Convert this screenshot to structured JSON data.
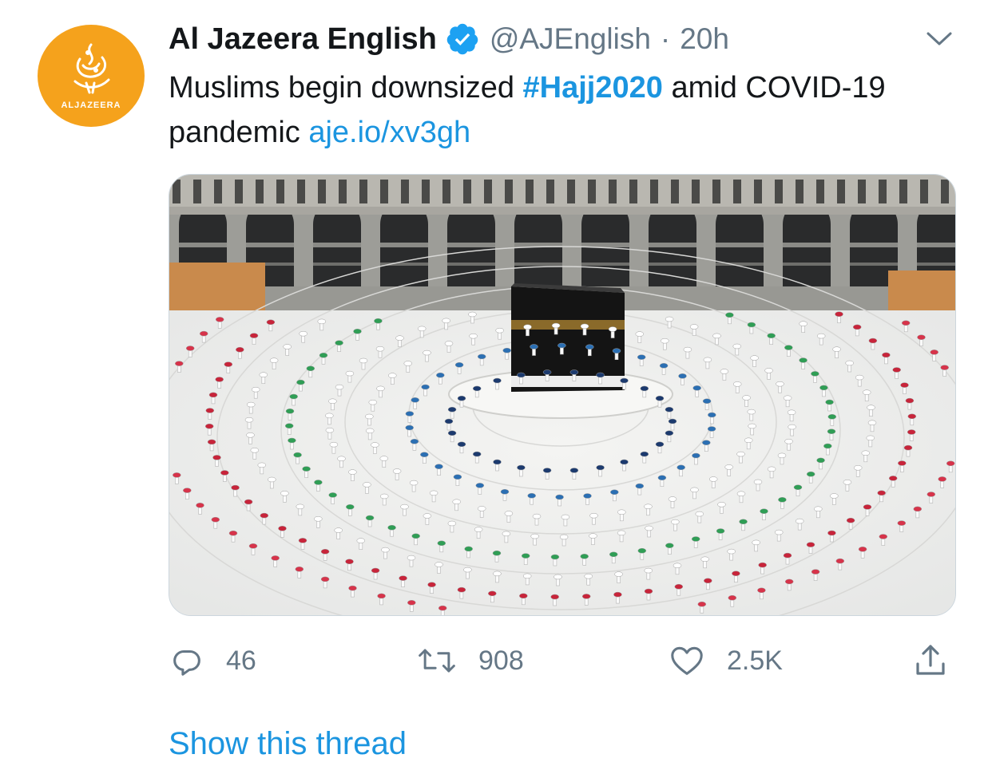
{
  "tweet": {
    "avatar": {
      "logo_text": "ALJAZEERA",
      "icon": "al-jazeera-logo-icon",
      "color": "#f5a21c"
    },
    "display_name": "Al Jazeera English",
    "verified_icon": "verified-badge-icon",
    "handle": "@AJEnglish",
    "separator": "·",
    "time": "20h",
    "menu_icon": "chevron-down-icon",
    "text_part1": "Muslims begin downsized ",
    "hashtag": "#Hajj2020",
    "text_part2": " amid COVID-19 pandemic ",
    "link": "aje.io/xv3gh",
    "accent_color": "#1b95e0",
    "media": {
      "description_icon": "photo-kaaba-pilgrims"
    },
    "actions": {
      "reply": {
        "icon": "reply-icon",
        "count": "46"
      },
      "retweet": {
        "icon": "retweet-icon",
        "count": "908"
      },
      "like": {
        "icon": "heart-icon",
        "count": "2.5K"
      },
      "share": {
        "icon": "share-icon"
      }
    },
    "show_thread": "Show this thread"
  }
}
